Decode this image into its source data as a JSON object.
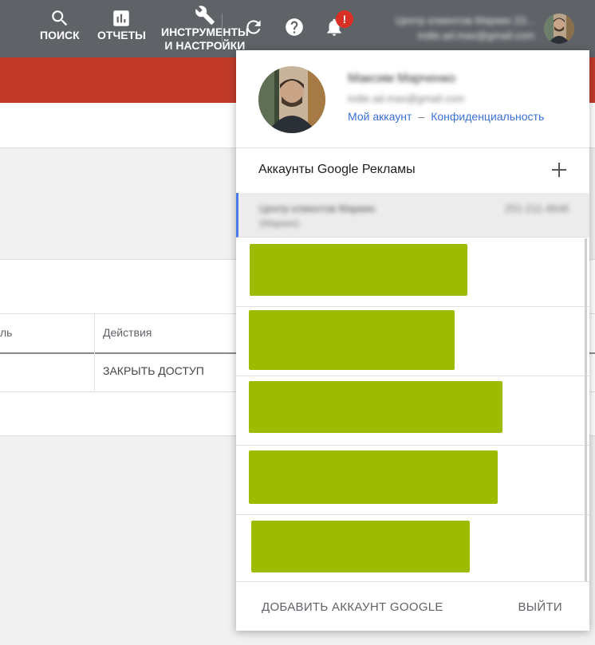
{
  "topbar": {
    "search_label": "ПОИСК",
    "reports_label": "ОТЧЕТЫ",
    "tools_label_line1": "ИНСТРУМЕНТЫ",
    "tools_label_line2": "И НАСТРОЙКИ",
    "notification_badge": "!",
    "account_name": "Центр клиентов Маркин 23...",
    "account_email": "indie.ad.max@gmail.com"
  },
  "table": {
    "col1_header": "ль",
    "col2_header": "Действия",
    "row_action": "ЗАКРЫТЬ ДОСТУП"
  },
  "popup": {
    "user_name": "Максим Марченко",
    "user_email": "indie.ad.max@gmail.com",
    "my_account_link": "Мой аккаунт",
    "link_separator": "–",
    "privacy_link": "Конфиденциальность",
    "ads_accounts_title": "Аккаунты Google Рекламы",
    "selected_account": {
      "name": "Центр клиентов Маркин",
      "subtitle": "(Маркин)",
      "id": "251-211-4848"
    },
    "add_account_label": "ДОБАВИТЬ АККАУНТ GOOGLE",
    "logout_label": "ВЫЙТИ"
  },
  "colors": {
    "topbar": "#5f6368",
    "red_band": "#c23b2a",
    "redaction": "#9dbb00",
    "link": "#3b70d6",
    "badge": "#d93025"
  }
}
